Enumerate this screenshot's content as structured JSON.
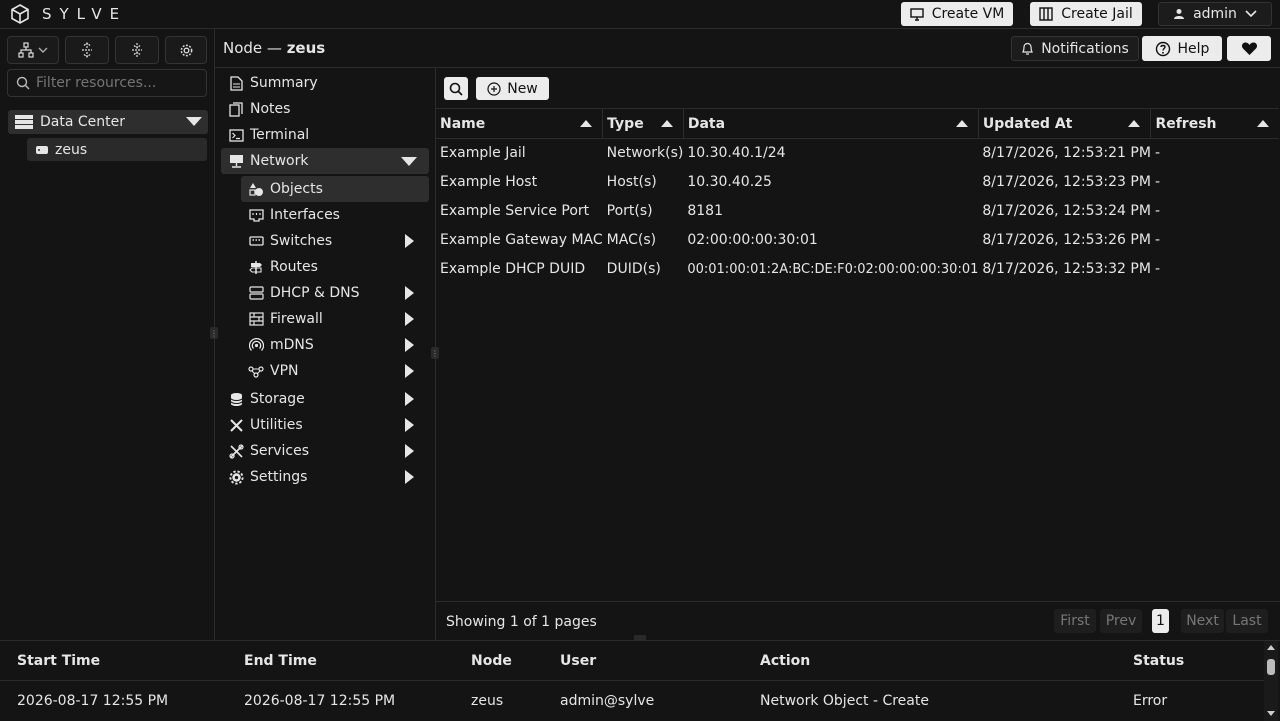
{
  "app": {
    "name": "SYLVE"
  },
  "topbar": {
    "create_vm": "Create VM",
    "create_jail": "Create Jail",
    "user": "admin"
  },
  "sidebar": {
    "filter_placeholder": "Filter resources...",
    "datacenter": "Data Center",
    "node": "zeus"
  },
  "header": {
    "title_prefix": "Node —",
    "title_node": "zeus",
    "notifications": "Notifications",
    "help": "Help"
  },
  "menu": {
    "summary": "Summary",
    "notes": "Notes",
    "terminal": "Terminal",
    "network": "Network",
    "objects": "Objects",
    "interfaces": "Interfaces",
    "switches": "Switches",
    "routes": "Routes",
    "dhcp": "DHCP & DNS",
    "firewall": "Firewall",
    "mdns": "mDNS",
    "vpn": "VPN",
    "storage": "Storage",
    "utilities": "Utilities",
    "services": "Services",
    "settings": "Settings"
  },
  "toolbar": {
    "new": "New"
  },
  "table": {
    "headers": [
      "Name",
      "Type",
      "Data",
      "Updated At",
      "Refresh"
    ],
    "rows": [
      [
        "Example Jail",
        "Network(s)",
        "10.30.40.1/24",
        "8/17/2026, 12:53:21 PM",
        "-"
      ],
      [
        "Example Host",
        "Host(s)",
        "10.30.40.25",
        "8/17/2026, 12:53:23 PM",
        "-"
      ],
      [
        "Example Service Port",
        "Port(s)",
        "8181",
        "8/17/2026, 12:53:24 PM",
        "-"
      ],
      [
        "Example Gateway MAC",
        "MAC(s)",
        "02:00:00:00:30:01",
        "8/17/2026, 12:53:26 PM",
        "-"
      ],
      [
        "Example DHCP DUID",
        "DUID(s)",
        "00:01:00:01:2A:BC:DE:F0:02:00:00:00:30:01",
        "8/17/2026, 12:53:32 PM",
        "-"
      ]
    ]
  },
  "pager": {
    "text": "Showing 1 of 1 pages",
    "first": "First",
    "prev": "Prev",
    "page": "1",
    "next": "Next",
    "last": "Last"
  },
  "tasks": {
    "headers": [
      "Start Time",
      "End Time",
      "Node",
      "User",
      "Action",
      "Status"
    ],
    "rows": [
      [
        "2026-08-17 12:55 PM",
        "2026-08-17 12:55 PM",
        "zeus",
        "admin@sylve",
        "Network Object - Create",
        "Error"
      ]
    ]
  }
}
